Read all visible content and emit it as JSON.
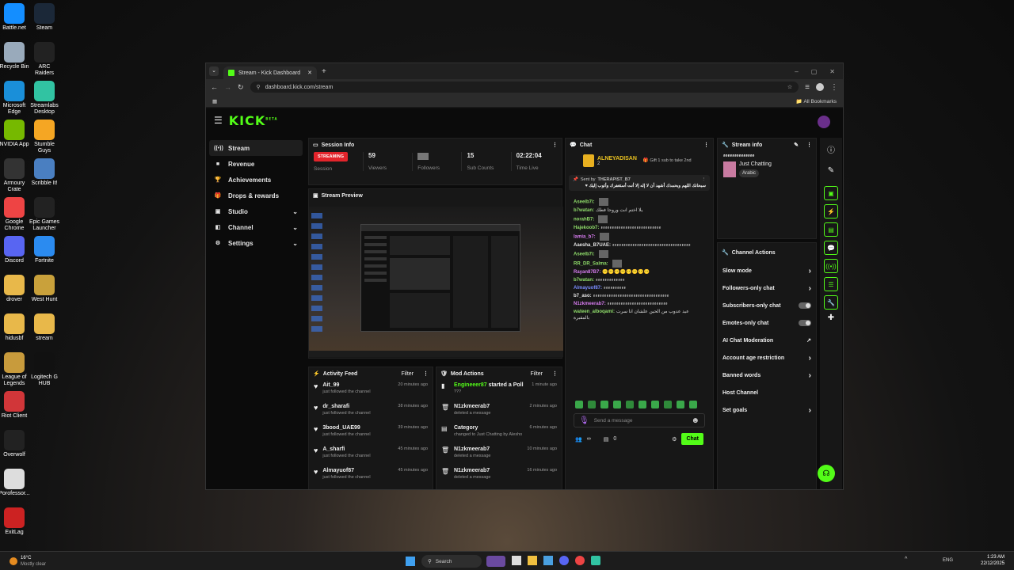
{
  "desktop_icons": [
    {
      "label": "Battle.net",
      "color": "#148eff"
    },
    {
      "label": "Steam",
      "color": "#1b2838"
    },
    {
      "label": "Recycle Bin",
      "color": "#9ab"
    },
    {
      "label": "ARC Raiders",
      "color": "#222"
    },
    {
      "label": "Microsoft Edge",
      "color": "#1a8fd9"
    },
    {
      "label": "Streamlabs Desktop",
      "color": "#31c3a2"
    },
    {
      "label": "NVIDIA App",
      "color": "#76b900"
    },
    {
      "label": "Stumble Guys",
      "color": "#f5a623"
    },
    {
      "label": "Armoury Crate",
      "color": "#333"
    },
    {
      "label": "Scribble It!",
      "color": "#4a7fc1"
    },
    {
      "label": "Google Chrome",
      "color": "#e44"
    },
    {
      "label": "Epic Games Launcher",
      "color": "#222"
    },
    {
      "label": "Discord",
      "color": "#5865f2"
    },
    {
      "label": "Fortnite",
      "color": "#2b8bf0"
    },
    {
      "label": "drover",
      "color": "#e8b84a"
    },
    {
      "label": "West Hunt",
      "color": "#c9a13b"
    },
    {
      "label": "hidusbf",
      "color": "#e8b84a"
    },
    {
      "label": "stream",
      "color": "#e8b84a"
    },
    {
      "label": "League of Legends",
      "color": "#c89b3c"
    },
    {
      "label": "Logitech G HUB",
      "color": "#111"
    },
    {
      "label": "Riot Client",
      "color": "#d13639"
    },
    {
      "label": "",
      "color": "transparent"
    },
    {
      "label": "Overwolf",
      "color": "#222"
    },
    {
      "label": "",
      "color": "transparent"
    },
    {
      "label": "Porofessor...",
      "color": "#ddd"
    },
    {
      "label": "",
      "color": "transparent"
    },
    {
      "label": "ExitLag",
      "color": "#c22"
    },
    {
      "label": "",
      "color": "transparent"
    }
  ],
  "browser": {
    "tab_title": "Stream - Kick Dashboard",
    "url": "dashboard.kick.com/stream",
    "bookmarks": "All Bookmarks"
  },
  "app": {
    "logo": "KICK",
    "logo_sup": "BETA"
  },
  "sidebar": [
    {
      "label": "Stream",
      "icon": "((•))",
      "active": true
    },
    {
      "label": "Revenue",
      "icon": "■"
    },
    {
      "label": "Achievements",
      "icon": "🏆"
    },
    {
      "label": "Drops & rewards",
      "icon": "🎁"
    },
    {
      "label": "Studio",
      "icon": "▣",
      "chev": "⌄"
    },
    {
      "label": "Channel",
      "icon": "◧",
      "chev": "⌄"
    },
    {
      "label": "Settings",
      "icon": "⚙",
      "chev": "⌄"
    }
  ],
  "session": {
    "title": "Session Info",
    "status": "STREAMING",
    "status_label": "Session",
    "viewers": "59",
    "viewers_label": "Viewers",
    "followers_label": "Followers",
    "subs": "15",
    "subs_label": "Sub Counts",
    "time": "02:22:04",
    "time_label": "Time Live"
  },
  "preview": {
    "title": "Stream Preview"
  },
  "activity": {
    "title": "Activity Feed",
    "filter": "Filter",
    "items": [
      {
        "name": "Ait_99",
        "action": "just followed the channel",
        "time": "20 minutes ago"
      },
      {
        "name": "dr_sharafi",
        "action": "just followed the channel",
        "time": "38 minutes ago"
      },
      {
        "name": "3bood_UAE99",
        "action": "just followed the channel",
        "time": "39 minutes ago"
      },
      {
        "name": "A_sharfi",
        "action": "just followed the channel",
        "time": "45 minutes ago"
      },
      {
        "name": "Almayuof87",
        "action": "just followed the channel",
        "time": "45 minutes ago"
      }
    ]
  },
  "mod": {
    "title": "Mod Actions",
    "filter": "Filter",
    "items": [
      {
        "icon": "▮",
        "name": "Engineeer87",
        "extra": " started a Poll",
        "sub": "???",
        "time": "1 minute ago"
      },
      {
        "icon": "🗑",
        "name": "N1zkmeerab7",
        "extra": "",
        "sub": "deleted a message",
        "time": "2 minutes ago"
      },
      {
        "icon": "▤",
        "name": "Category",
        "extra": "",
        "sub": "changed to Just Chatting by Alesho",
        "time": "6 minutes ago"
      },
      {
        "icon": "🗑",
        "name": "N1zkmeerab7",
        "extra": "",
        "sub": "deleted a message",
        "time": "10 minutes ago"
      },
      {
        "icon": "🗑",
        "name": "N1zkmeerab7",
        "extra": "",
        "sub": "deleted a message",
        "time": "16 minutes ago"
      }
    ]
  },
  "chat": {
    "title": "Chat",
    "top_gifter": "ALNEYADISAN",
    "top_count": "2",
    "gift_text": "Gift 1 sub to take 2nd",
    "pinned_by": "Sent by",
    "pinned_user": "THERAPIST_B7",
    "pinned_msg": "سبحانك اللهم وبحمدك أشهد أن لا إله إلا أنت أستغفرك وأتوب إليك ♥",
    "messages": [
      {
        "user": "Aseelb7i:",
        "color": "#8fdc6a",
        "text": ""
      },
      {
        "user": "b7watan:",
        "color": "#8fdc6a",
        "text": "يلا اختم انت وروحا فطك"
      },
      {
        "user": "norahB7:",
        "color": "#8fdc6a",
        "text": ""
      },
      {
        "user": "Hajekoob7:",
        "color": "#8fdc6a",
        "text": "ءءءءءءءءءءءءءءءءءءءءءءءءءءء"
      },
      {
        "user": "lamia_b7:",
        "color": "#d77cf0",
        "text": ""
      },
      {
        "user": "Aaesha_B7UAE:",
        "color": "#e6e6e6",
        "text": "ءءءءءءءءءءءءءءءءءءءءءءءءءءءءءءءءءءء"
      },
      {
        "user": "Aseelb7i:",
        "color": "#8fdc6a",
        "text": ""
      },
      {
        "user": "RR_DR_Salma:",
        "color": "#8fdc6a",
        "text": ""
      },
      {
        "user": "Rayan87B7:",
        "color": "#d77cf0",
        "text": "😶😶😶😶😶😶😶😶"
      },
      {
        "user": "b7watan:",
        "color": "#8fdc6a",
        "text": "ءءءءءءءءءءءءء"
      },
      {
        "user": "Almayuof87:",
        "color": "#7a8cff",
        "text": "ءءءءءءءءءء"
      },
      {
        "user": "b7_aso:",
        "color": "#e6e6e6",
        "text": "ءءءءءءءءءءءءءءءءءءءءءءءءءءءءءءءءءء"
      },
      {
        "user": "N1zkmeerab7:",
        "color": "#d77cf0",
        "text": "ءءءءءءءءءءءءءءءءءءءءءءءءءءء"
      },
      {
        "user": "wateen_alboqami:",
        "color": "#8fdc6a",
        "text": "عيد عدوب من الحين علشان انا سرت بالمقبرة"
      }
    ],
    "input_placeholder": "Send a message",
    "send_label": "Chat",
    "count_left": "∞",
    "count_right": "0"
  },
  "stream_info": {
    "title": "Stream info",
    "stream_title": "ءءءءءءءءءءءءءء",
    "category": "Just Chatting",
    "tag": "Arabic"
  },
  "channel_actions": {
    "title": "Channel Actions",
    "items": [
      {
        "label": "Slow mode",
        "ctrl": "chevron"
      },
      {
        "label": "Followers-only chat",
        "ctrl": "chevron"
      },
      {
        "label": "Subscribers-only chat",
        "ctrl": "toggle"
      },
      {
        "label": "Emotes-only chat",
        "ctrl": "toggle"
      },
      {
        "label": "AI Chat Moderation",
        "ctrl": "link"
      },
      {
        "label": "Account age restriction",
        "ctrl": "chevron"
      },
      {
        "label": "Banned words",
        "ctrl": "chevron"
      },
      {
        "label": "Host Channel",
        "ctrl": ""
      },
      {
        "label": "Set goals",
        "ctrl": "chevron"
      }
    ]
  },
  "taskbar": {
    "temp": "16°C",
    "weather": "Mostly clear",
    "search": "Search",
    "lang": "ENG",
    "time": "1:23 AM",
    "date": "22/12/2025"
  },
  "colors": {
    "accent": "#53fc18",
    "streaming": "#e3242b"
  }
}
